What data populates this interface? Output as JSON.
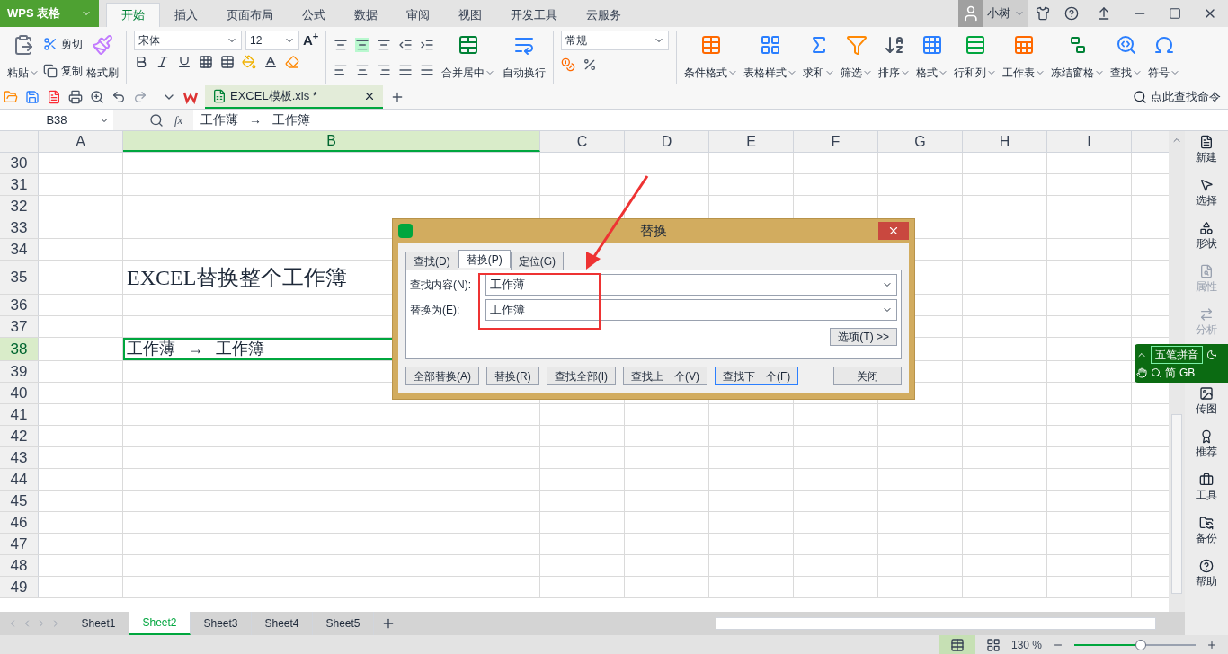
{
  "app": {
    "name": "WPS 表格",
    "user": "小树"
  },
  "menu_tabs": [
    {
      "label": "开始",
      "selected": true
    },
    {
      "label": "插入",
      "selected": false
    },
    {
      "label": "页面布局",
      "selected": false
    },
    {
      "label": "公式",
      "selected": false
    },
    {
      "label": "数据",
      "selected": false
    },
    {
      "label": "审阅",
      "selected": false
    },
    {
      "label": "视图",
      "selected": false
    },
    {
      "label": "开发工具",
      "selected": false
    },
    {
      "label": "云服务",
      "selected": false
    }
  ],
  "ribbon": {
    "paste": "粘贴",
    "cut": "剪切",
    "copy": "复制",
    "format_painter": "格式刷",
    "font": "宋体",
    "font_size": "12",
    "grow_font": "A",
    "grow_font_mark": "+",
    "merge": "合并居中",
    "wrap": "自动换行",
    "number_format": "常规",
    "big_buttons": [
      {
        "label": "条件格式",
        "kind": "cond"
      },
      {
        "label": "表格样式",
        "kind": "style"
      },
      {
        "label": "求和",
        "kind": "sum"
      },
      {
        "label": "筛选",
        "kind": "filter"
      },
      {
        "label": "排序",
        "kind": "sort"
      },
      {
        "label": "格式",
        "kind": "format"
      },
      {
        "label": "行和列",
        "kind": "rowcol"
      },
      {
        "label": "工作表",
        "kind": "sheet"
      },
      {
        "label": "冻结窗格",
        "kind": "freeze"
      },
      {
        "label": "查找",
        "kind": "find"
      },
      {
        "label": "符号",
        "kind": "symbol"
      }
    ]
  },
  "document_tab": "EXCEL模板.xls *",
  "command_search": {
    "placeholder": "点此查找命令"
  },
  "name_box": "B38",
  "function_label": "fx",
  "formula": "工作薄   →   工作簿",
  "columns": [
    {
      "label": "A",
      "selected": false
    },
    {
      "label": "B",
      "selected": true
    },
    {
      "label": "C",
      "selected": false
    },
    {
      "label": "D",
      "selected": false
    },
    {
      "label": "E",
      "selected": false
    },
    {
      "label": "F",
      "selected": false
    },
    {
      "label": "G",
      "selected": false
    },
    {
      "label": "H",
      "selected": false
    },
    {
      "label": "I",
      "selected": false
    }
  ],
  "rows": [
    {
      "number": "30",
      "selected": false
    },
    {
      "number": "31",
      "selected": false
    },
    {
      "number": "32",
      "selected": false
    },
    {
      "number": "33",
      "selected": false
    },
    {
      "number": "34",
      "selected": false
    },
    {
      "number": "35",
      "selected": false,
      "b": "EXCEL替换整个工作簿",
      "kind": "title"
    },
    {
      "number": "36",
      "selected": false
    },
    {
      "number": "37",
      "selected": false
    },
    {
      "number": "38",
      "selected": true,
      "b": "工作薄   →   工作簿",
      "kind": "normal"
    },
    {
      "number": "39",
      "selected": false
    },
    {
      "number": "40",
      "selected": false
    },
    {
      "number": "41",
      "selected": false
    },
    {
      "number": "42",
      "selected": false
    },
    {
      "number": "43",
      "selected": false
    },
    {
      "number": "44",
      "selected": false
    },
    {
      "number": "45",
      "selected": false
    },
    {
      "number": "46",
      "selected": false
    },
    {
      "number": "47",
      "selected": false
    },
    {
      "number": "48",
      "selected": false
    },
    {
      "number": "49",
      "selected": false
    }
  ],
  "dialog": {
    "title": "替换",
    "tabs": [
      {
        "label": "查找(D)",
        "selected": false
      },
      {
        "label": "替换(P)",
        "selected": true
      },
      {
        "label": "定位(G)",
        "selected": false
      }
    ],
    "fields": [
      {
        "label": "查找内容(N):",
        "value": "工作薄"
      },
      {
        "label": "替换为(E):",
        "value": "工作簿"
      }
    ],
    "options_button": "选项(T) >>",
    "buttons": [
      {
        "label": "全部替换(A)",
        "focused": false
      },
      {
        "label": "替换(R)",
        "focused": false
      },
      {
        "label": "查找全部(I)",
        "focused": false
      },
      {
        "label": "查找上一个(V)",
        "focused": false
      },
      {
        "label": "查找下一个(F)",
        "focused": true
      }
    ],
    "close_button": "关闭"
  },
  "sidebar": [
    {
      "label": "新建",
      "disabled": false
    },
    {
      "label": "选择",
      "disabled": false
    },
    {
      "label": "形状",
      "disabled": false
    },
    {
      "label": "属性",
      "disabled": true
    },
    {
      "label": "分析",
      "disabled": true
    },
    {
      "label": "传图",
      "disabled": false
    },
    {
      "label": "推荐",
      "disabled": false
    },
    {
      "label": "工具",
      "disabled": false
    },
    {
      "label": "备份",
      "disabled": false
    },
    {
      "label": "帮助",
      "disabled": false
    }
  ],
  "ime": {
    "mode": "五笔拼音",
    "script": "简",
    "charset": "GB"
  },
  "sheets": [
    {
      "label": "Sheet1",
      "selected": false
    },
    {
      "label": "Sheet2",
      "selected": true
    },
    {
      "label": "Sheet3",
      "selected": false
    },
    {
      "label": "Sheet4",
      "selected": false
    },
    {
      "label": "Sheet5",
      "selected": false
    }
  ],
  "status": {
    "zoom": "130 %",
    "zoom_slider": {
      "level": 0.55
    }
  }
}
